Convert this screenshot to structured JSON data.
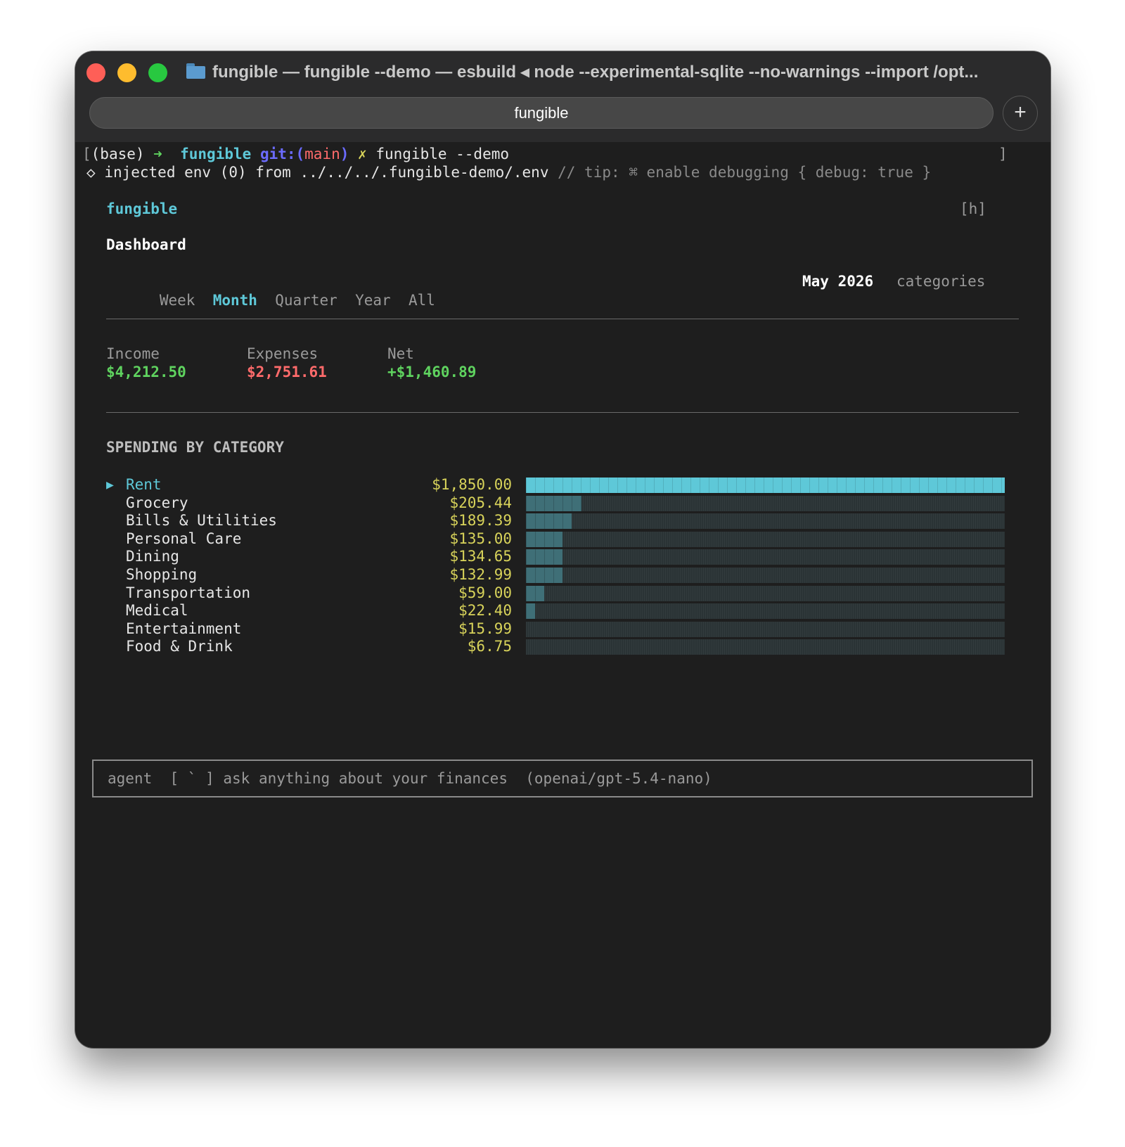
{
  "window": {
    "title": "fungible — fungible --demo — esbuild ◂ node --experimental-sqlite --no-warnings --import /opt...",
    "tab_label": "fungible",
    "new_tab_label": "+"
  },
  "prompt": {
    "open_bracket": "[",
    "env": "(base)",
    "arrow": "➜",
    "dir": "fungible",
    "git_label": "git:(",
    "branch": "main",
    "git_close": ")",
    "dirty": "✗",
    "command": "fungible --demo",
    "close_bracket": "]"
  },
  "env_line": {
    "symbol": "◇",
    "message": "injected env (0) from ../../../.fungible-demo/.env",
    "tip": "// tip: ⌘ enable debugging { debug: true }"
  },
  "app": {
    "name": "fungible",
    "help_hint": "[h]",
    "view_title": "Dashboard"
  },
  "periods": [
    {
      "label": "Week",
      "active": false
    },
    {
      "label": "Month",
      "active": true
    },
    {
      "label": "Quarter",
      "active": false
    },
    {
      "label": "Year",
      "active": false
    },
    {
      "label": "All",
      "active": false
    }
  ],
  "current_period": "May 2026",
  "view_mode": "categories",
  "summary": {
    "income_label": "Income",
    "income_value": "$4,212.50",
    "expenses_label": "Expenses",
    "expenses_value": "$2,751.61",
    "net_label": "Net",
    "net_value": "+$1,460.89"
  },
  "spending": {
    "heading": "SPENDING BY CATEGORY",
    "selected_marker": "▶"
  },
  "chart_data": {
    "type": "bar",
    "title": "SPENDING BY CATEGORY",
    "categories": [
      "Rent",
      "Grocery",
      "Bills & Utilities",
      "Personal Care",
      "Dining",
      "Shopping",
      "Transportation",
      "Medical",
      "Entertainment",
      "Food & Drink"
    ],
    "value_labels": [
      "$1,850.00",
      "$205.44",
      "$189.39",
      "$135.00",
      "$134.65",
      "$132.99",
      "$59.00",
      "$22.40",
      "$15.99",
      "$6.75"
    ],
    "values": [
      1850.0,
      205.44,
      189.39,
      135.0,
      134.65,
      132.99,
      59.0,
      22.4,
      15.99,
      6.75
    ],
    "selected_index": 0,
    "orientation": "horizontal"
  },
  "agent": {
    "label": "agent",
    "shortcut": "[ ` ]",
    "placeholder": "ask anything about your finances",
    "model": "(openai/gpt-5.4-nano)"
  },
  "colors": {
    "accent_cyan": "#5ec8d8",
    "income_green": "#5fd35f",
    "expense_red": "#ff6b6b",
    "amount_yellow": "#d8d35a",
    "bar_dim": "#3f6f77"
  }
}
